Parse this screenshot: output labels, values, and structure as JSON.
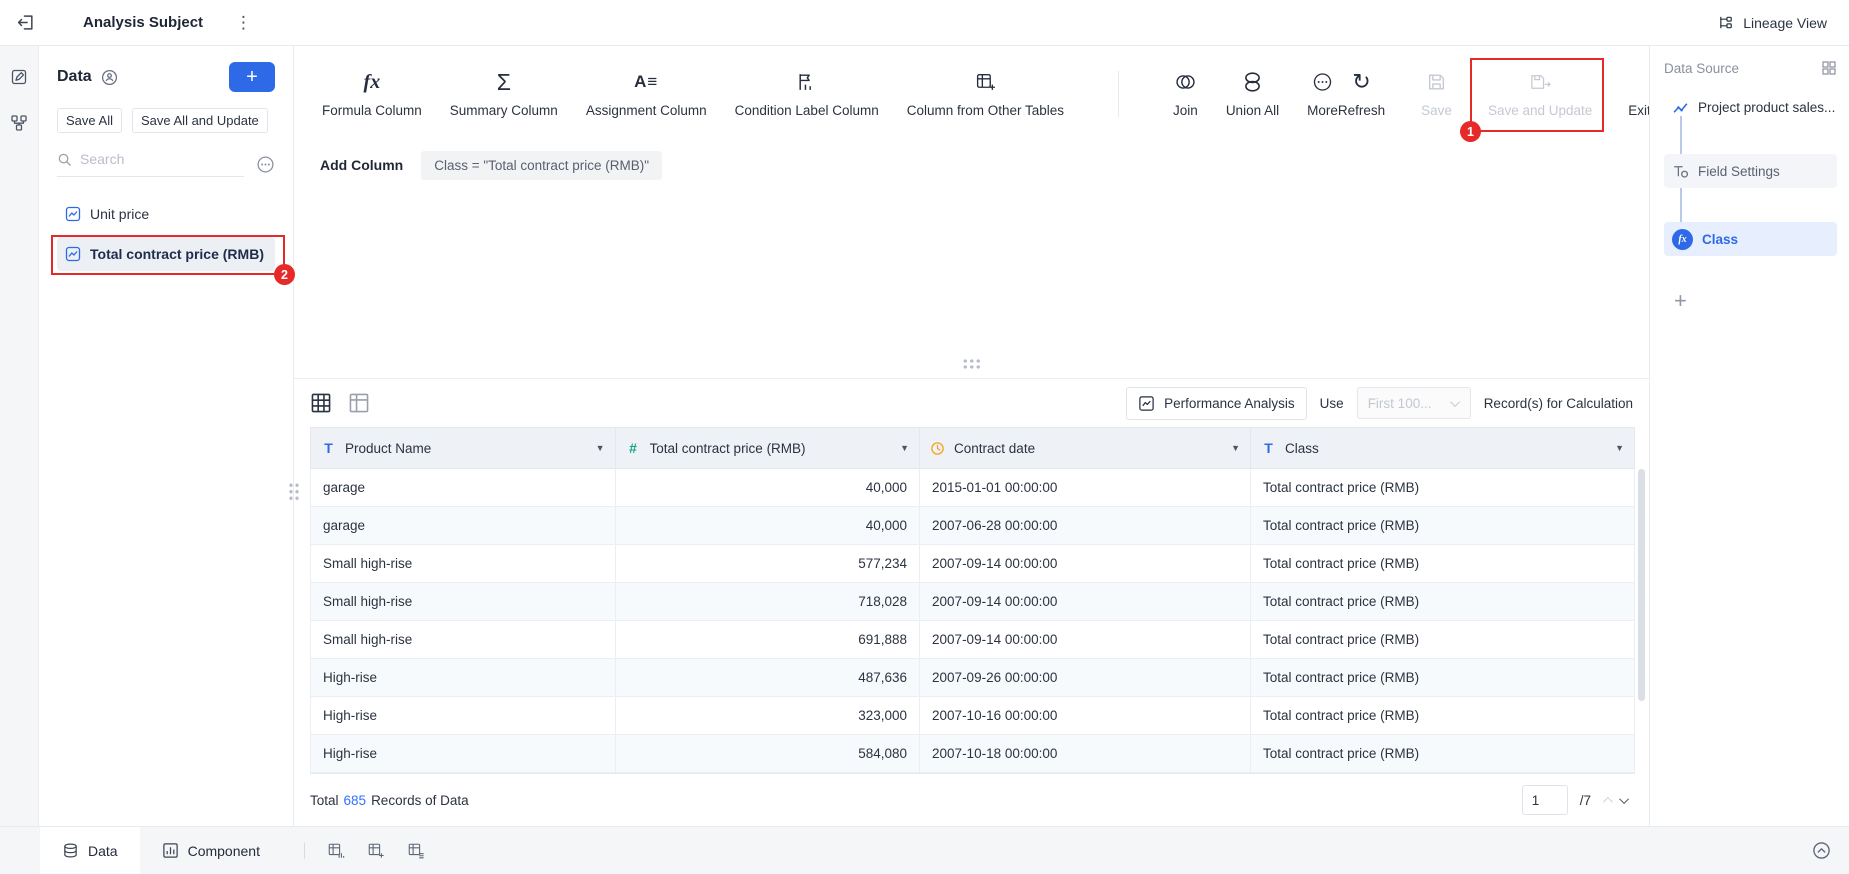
{
  "topbar": {
    "title": "Analysis Subject",
    "lineage_view": "Lineage View"
  },
  "icons": {
    "kebab": "⋮",
    "plus": "+",
    "sigma": "Σ",
    "fx": "fx",
    "assignment": "A≡",
    "refresh": "↻",
    "dropdown_caret": "▼",
    "text_type": "T",
    "number_type": "#"
  },
  "left_panel": {
    "title": "Data",
    "save_all_label": "Save All",
    "save_all_update_label": "Save All and Update",
    "search_placeholder": "Search",
    "items": [
      {
        "label": "Unit price"
      },
      {
        "label": "Total contract price (RMB)"
      }
    ]
  },
  "toolbar": {
    "formula_column": "Formula Column",
    "summary_column": "Summary Column",
    "assignment_column": "Assignment Column",
    "condition_label_column": "Condition Label Column",
    "column_from_other_tables": "Column from Other Tables",
    "join": "Join",
    "union_all": "Union All",
    "more": "More",
    "refresh": "Refresh",
    "save": "Save",
    "save_and_update": "Save and Update",
    "exit_and_preview": "Exit and Preview"
  },
  "annotations": {
    "badge_1": "1",
    "badge_2": "2"
  },
  "add_column": {
    "label": "Add Column",
    "formula_chip": "Class = \"Total contract price (RMB)\""
  },
  "table_toolbar": {
    "performance_analysis": "Performance Analysis",
    "use_label": "Use",
    "records_select_value": "First 100...",
    "records_suffix": "Record(s) for Calculation"
  },
  "table": {
    "columns": [
      {
        "label": "Product Name"
      },
      {
        "label": "Total contract price (RMB)"
      },
      {
        "label": "Contract date"
      },
      {
        "label": "Class"
      }
    ],
    "rows": [
      [
        "garage",
        "40,000",
        "2015-01-01 00:00:00",
        "Total contract price (RMB)"
      ],
      [
        "garage",
        "40,000",
        "2007-06-28 00:00:00",
        "Total contract price (RMB)"
      ],
      [
        "Small high-rise",
        "577,234",
        "2007-09-14 00:00:00",
        "Total contract price (RMB)"
      ],
      [
        "Small high-rise",
        "718,028",
        "2007-09-14 00:00:00",
        "Total contract price (RMB)"
      ],
      [
        "Small high-rise",
        "691,888",
        "2007-09-14 00:00:00",
        "Total contract price (RMB)"
      ],
      [
        "High-rise",
        "487,636",
        "2007-09-26 00:00:00",
        "Total contract price (RMB)"
      ],
      [
        "High-rise",
        "323,000",
        "2007-10-16 00:00:00",
        "Total contract price (RMB)"
      ],
      [
        "High-rise",
        "584,080",
        "2007-10-18 00:00:00",
        "Total contract price (RMB)"
      ]
    ]
  },
  "footer": {
    "total_label": "Total",
    "total_count": "685",
    "records_label": "Records of Data",
    "page_input": "1",
    "page_total": "/7"
  },
  "right_panel": {
    "title": "Data Source",
    "source_name": "Project product sales...",
    "field_settings": "Field Settings",
    "field_item": "Class"
  },
  "bottom_bar": {
    "data_tab": "Data",
    "component_tab": "Component"
  }
}
